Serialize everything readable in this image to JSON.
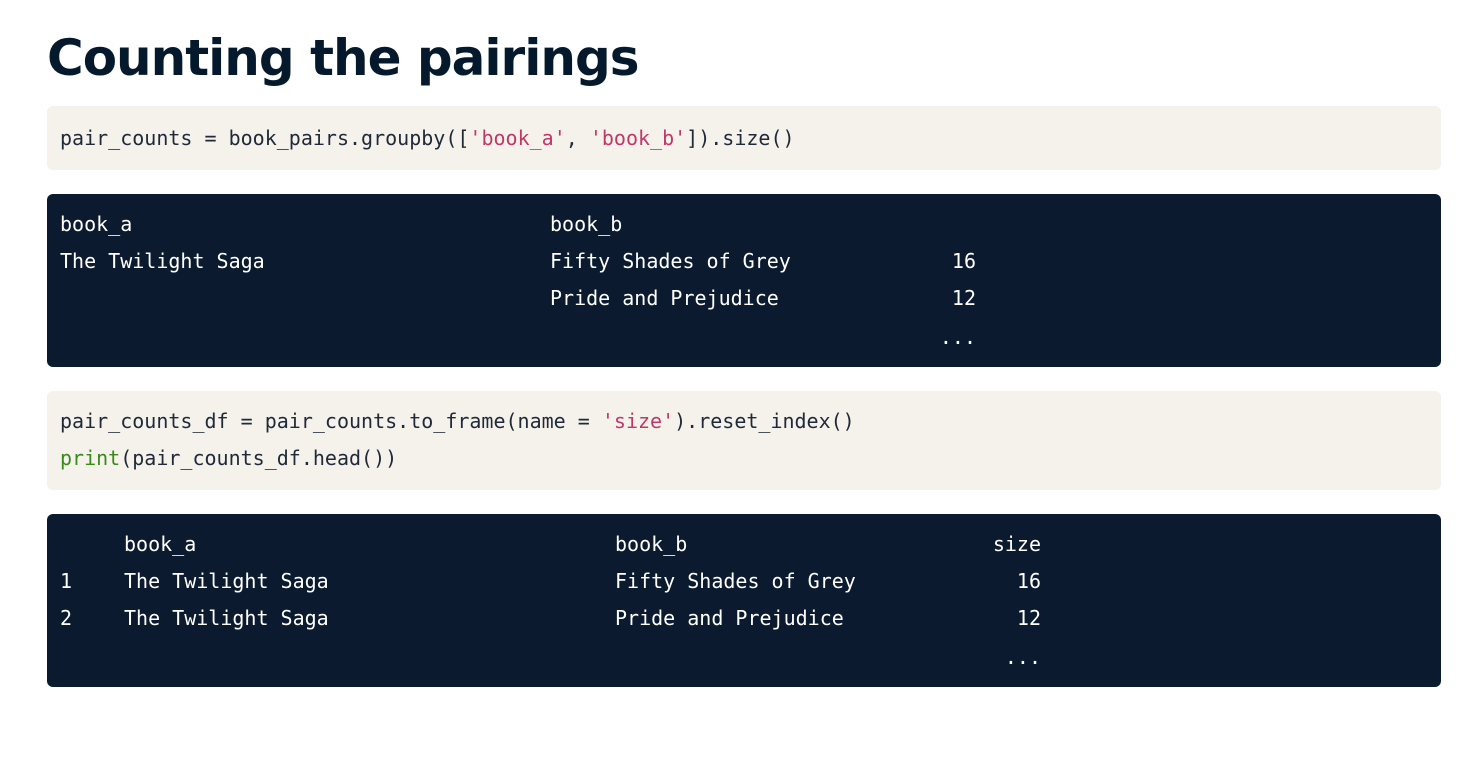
{
  "title": "Counting the pairings",
  "code1": {
    "part1": "pair_counts = book_pairs.groupby([",
    "str1": "'book_a'",
    "part2": ", ",
    "str2": "'book_b'",
    "part3": "]).size()"
  },
  "output1": {
    "header_a": "book_a",
    "header_b": "book_b",
    "rows": [
      {
        "book_a": "The Twilight Saga",
        "book_b": "Fifty Shades of Grey",
        "count": "16"
      },
      {
        "book_a": "",
        "book_b": "Pride and Prejudice",
        "count": "12"
      }
    ],
    "ellipsis": "..."
  },
  "code2": {
    "line1_part1": "pair_counts_df = pair_counts.to_frame(name = ",
    "line1_str": "'size'",
    "line1_part2": ").reset_index()",
    "line2_kw": "print",
    "line2_rest": "(pair_counts_df.head())"
  },
  "output2": {
    "header_a": "book_a",
    "header_b": "book_b",
    "header_size": "size",
    "rows": [
      {
        "index": "1",
        "book_a": "The Twilight Saga",
        "book_b": "Fifty Shades of Grey",
        "size": "16"
      },
      {
        "index": "2",
        "book_a": "The Twilight Saga",
        "book_b": "Pride and Prejudice",
        "size": "12"
      }
    ],
    "ellipsis": "..."
  }
}
